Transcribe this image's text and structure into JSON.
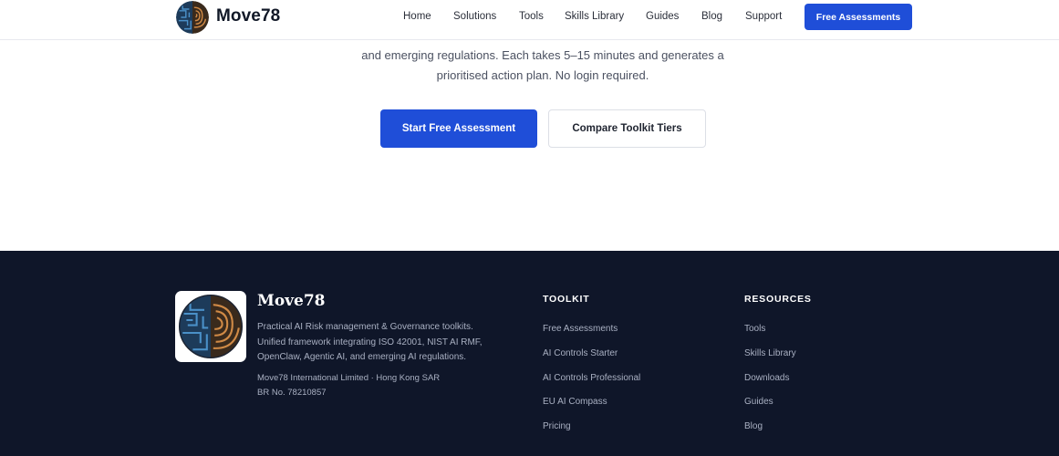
{
  "header": {
    "brand": "Move78",
    "nav": [
      "Home",
      "Solutions",
      "Tools",
      "Skills Library",
      "Guides",
      "Blog",
      "Support"
    ],
    "cta": "Free Assessments"
  },
  "hero": {
    "text_line1": "and emerging regulations. Each takes 5–15 minutes and generates a",
    "text_line2": "prioritised action plan. No login required.",
    "primary_button": "Start Free Assessment",
    "secondary_button": "Compare Toolkit Tiers"
  },
  "footer": {
    "brand": "Move78",
    "description": "Practical AI Risk management & Governance toolkits. Unified framework integrating ISO 42001, NIST AI RMF, OpenClaw, Agentic AI, and emerging AI regulations.",
    "company": "Move78 International Limited · Hong Kong SAR",
    "registration": "BR No. 78210857",
    "toolkit": {
      "title": "TOOLKIT",
      "items": [
        "Free Assessments",
        "AI Controls Starter",
        "AI Controls Professional",
        "EU AI Compass",
        "Pricing"
      ]
    },
    "resources": {
      "title": "RESOURCES",
      "items": [
        "Tools",
        "Skills Library",
        "Downloads",
        "Guides",
        "Blog"
      ]
    }
  },
  "colors": {
    "accent": "#1f4ed8",
    "footer_bg": "#0f1629",
    "logo_blue": "#2f6fa8",
    "logo_orange": "#c9793a"
  },
  "icons": {
    "logo": "circuit-maze-logo-icon"
  }
}
